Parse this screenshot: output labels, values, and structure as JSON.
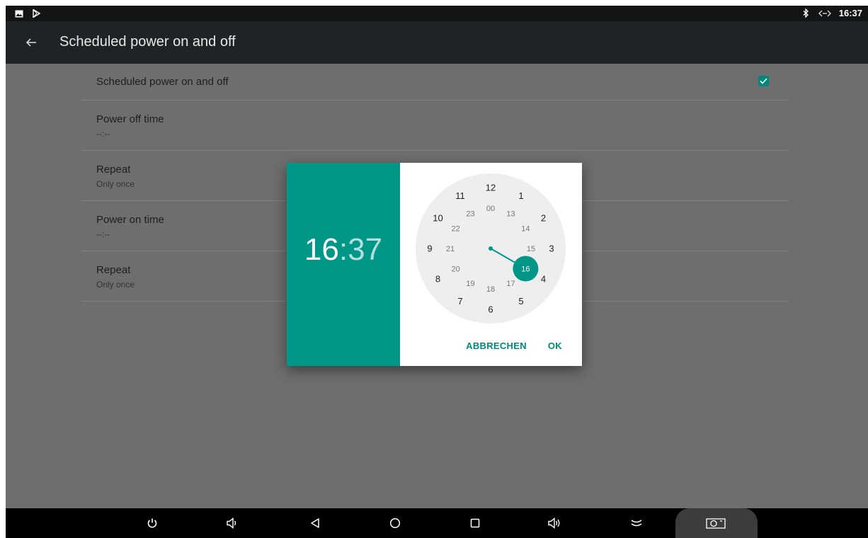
{
  "status_bar": {
    "time": "16:37",
    "left_icons": [
      "image-icon",
      "play-store-icon"
    ],
    "right_icons": [
      "bluetooth-icon",
      "ethernet-icon"
    ]
  },
  "app_bar": {
    "title": "Scheduled power on and off",
    "back_icon": "arrow-back-icon"
  },
  "settings": {
    "enable": {
      "label": "Scheduled power on and off",
      "checked": true
    },
    "power_off": {
      "label": "Power off time",
      "value": "--:--"
    },
    "repeat_off": {
      "label": "Repeat",
      "value": "Only once"
    },
    "power_on": {
      "label": "Power on time",
      "value": "--:--"
    },
    "repeat_on": {
      "label": "Repeat",
      "value": "Only once"
    }
  },
  "time_picker": {
    "hour": "16",
    "separator": ":",
    "minute": "37",
    "outer_hours": [
      "12",
      "1",
      "2",
      "3",
      "4",
      "5",
      "6",
      "7",
      "8",
      "9",
      "10",
      "11"
    ],
    "inner_hours": [
      "00",
      "13",
      "14",
      "15",
      "16",
      "17",
      "18",
      "19",
      "20",
      "21",
      "22",
      "23"
    ],
    "selected_hour": "16",
    "cancel_label": "ABBRECHEN",
    "ok_label": "OK",
    "accent_color": "#009688"
  },
  "nav_bar": {
    "icons": [
      "power-icon",
      "volume-down-icon",
      "back-icon",
      "home-icon",
      "recents-icon",
      "volume-up-icon",
      "collapse-icon",
      "screenshot-icon"
    ]
  }
}
